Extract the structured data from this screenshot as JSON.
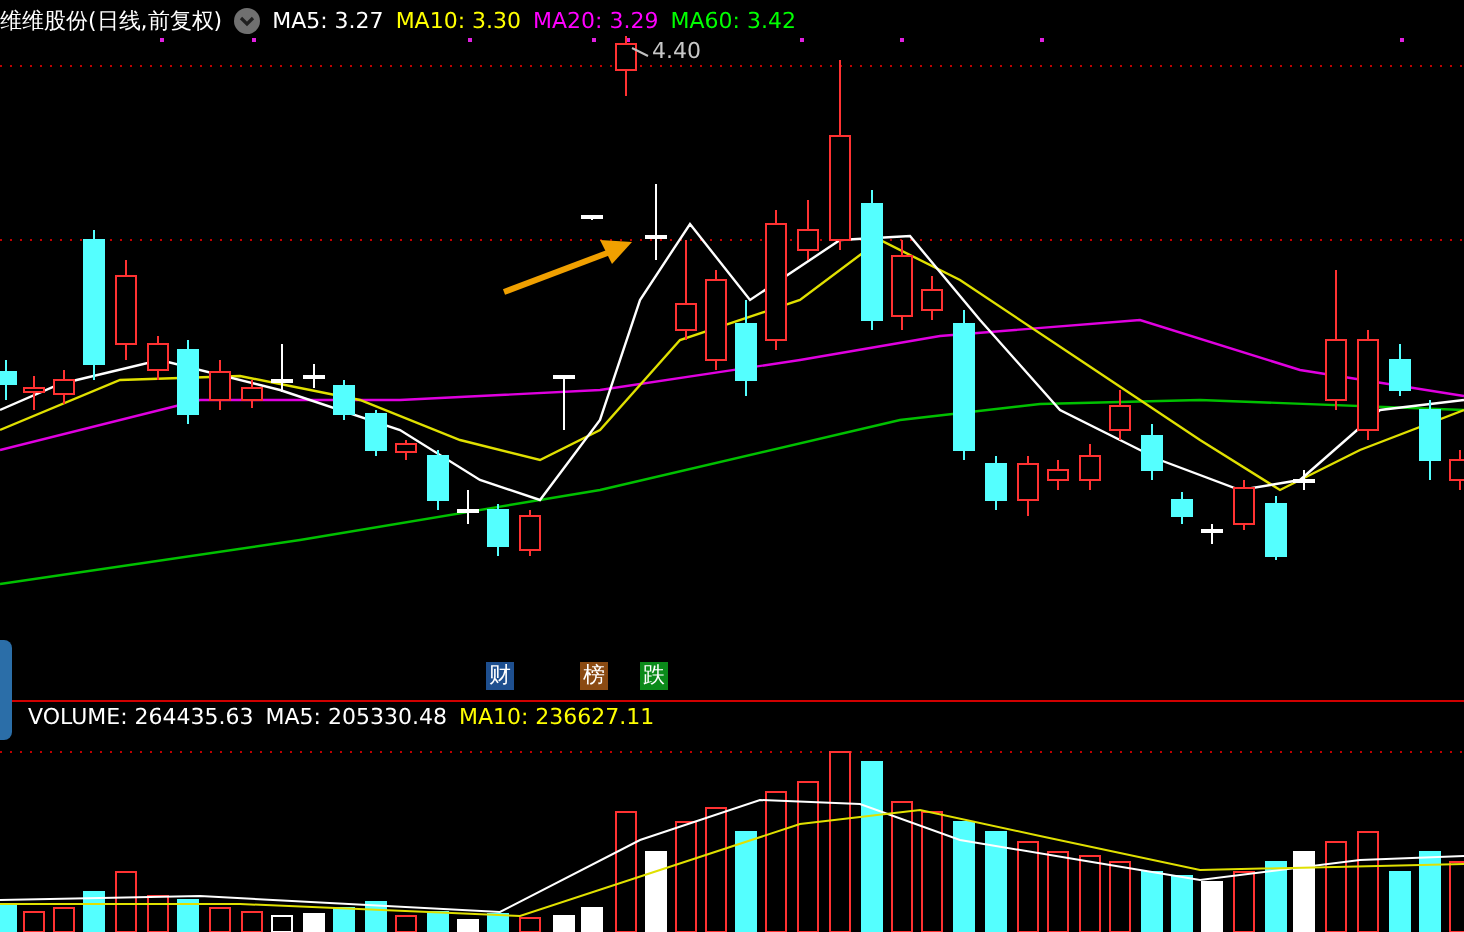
{
  "header": {
    "title": "维维股份(日线,前复权)",
    "indicators": [
      {
        "label": "MA5: 3.27",
        "color": "#ffffff"
      },
      {
        "label": "MA10: 3.30",
        "color": "#ffff00"
      },
      {
        "label": "MA20: 3.29",
        "color": "#ff00ff"
      },
      {
        "label": "MA60: 3.42",
        "color": "#00ff00"
      }
    ]
  },
  "price_chart": {
    "max_label": "4.40",
    "event_badges": [
      {
        "text": "财",
        "color": "#1e4f8f"
      },
      {
        "text": "榜",
        "color": "#8a4a12"
      },
      {
        "text": "跌",
        "color": "#0b8a1a"
      }
    ]
  },
  "volume_header": {
    "indicators": [
      {
        "label": "VOLUME: 264435.63",
        "color": "#ffffff"
      },
      {
        "label": "MA5: 205330.48",
        "color": "#ffffff"
      },
      {
        "label": "MA10: 236627.11",
        "color": "#ffff00"
      }
    ]
  }
}
